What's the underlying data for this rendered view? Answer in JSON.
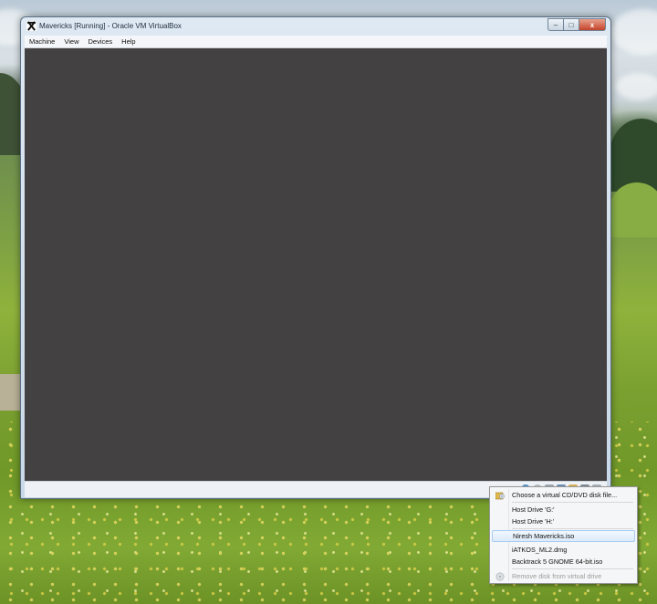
{
  "window": {
    "title": "Mavericks [Running] - Oracle VM VirtualBox",
    "controls": {
      "minimize": "–",
      "maximize": "□",
      "close": "x"
    }
  },
  "menubar": {
    "items": [
      {
        "label": "Machine"
      },
      {
        "label": "View"
      },
      {
        "label": "Devices"
      },
      {
        "label": "Help"
      }
    ]
  },
  "icons": {
    "app": "virtualbox-icon",
    "status": [
      "help-icon",
      "optical-drive-icon",
      "usb-icon",
      "network-icon",
      "shared-folder-icon",
      "display-icon",
      "capture-icon"
    ]
  },
  "context_menu": {
    "items": [
      {
        "label": "Choose a virtual CD/DVD disk file...",
        "icon": "folder-disk-icon",
        "state": "normal"
      },
      {
        "label": "Host Drive 'G:'",
        "state": "normal"
      },
      {
        "label": "Host Drive 'H:'",
        "state": "normal"
      },
      {
        "label": "Niresh Mavericks.iso",
        "state": "highlighted"
      },
      {
        "label": "iATKOS_ML2.dmg",
        "state": "normal"
      },
      {
        "label": "Backtrack 5 GNOME 64-bit.iso",
        "state": "normal"
      },
      {
        "label": "Remove disk from virtual drive",
        "icon": "remove-disk-icon",
        "state": "disabled"
      }
    ]
  },
  "colors": {
    "vm_screen": "#444142",
    "highlight_border": "#a9cdf3",
    "close_button": "#c5432b"
  }
}
